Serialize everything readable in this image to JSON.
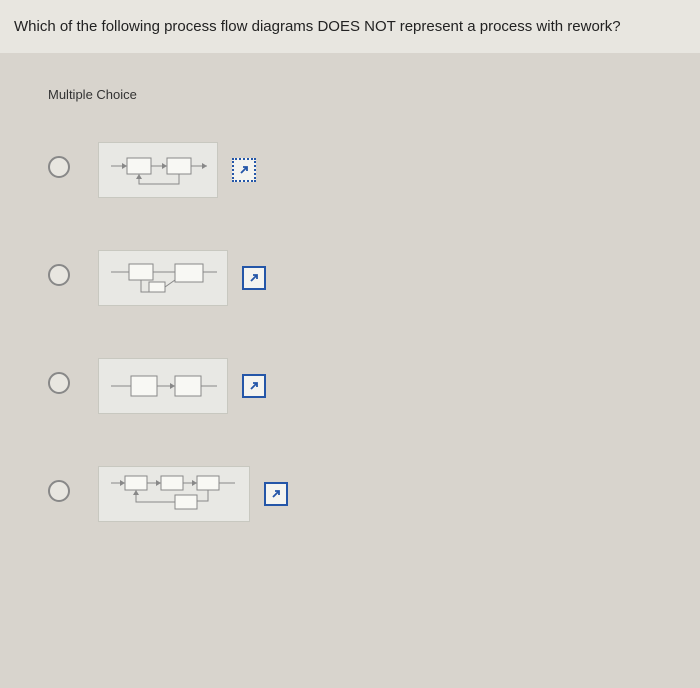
{
  "question": {
    "text": "Which of the following process flow diagrams DOES NOT represent a process with rework?"
  },
  "answer_type": "Multiple Choice",
  "options": [
    {
      "id": "a",
      "diagram_type": "rework loop back from box2 to box1",
      "expand_dotted": true
    },
    {
      "id": "b",
      "diagram_type": "rework loop back from box1 with offset",
      "expand_dotted": false
    },
    {
      "id": "c",
      "diagram_type": "linear two boxes no rework",
      "expand_dotted": false
    },
    {
      "id": "d",
      "diagram_type": "three boxes with rework loop under",
      "expand_dotted": false
    }
  ],
  "icons": {
    "expand": "expand-arrow"
  }
}
